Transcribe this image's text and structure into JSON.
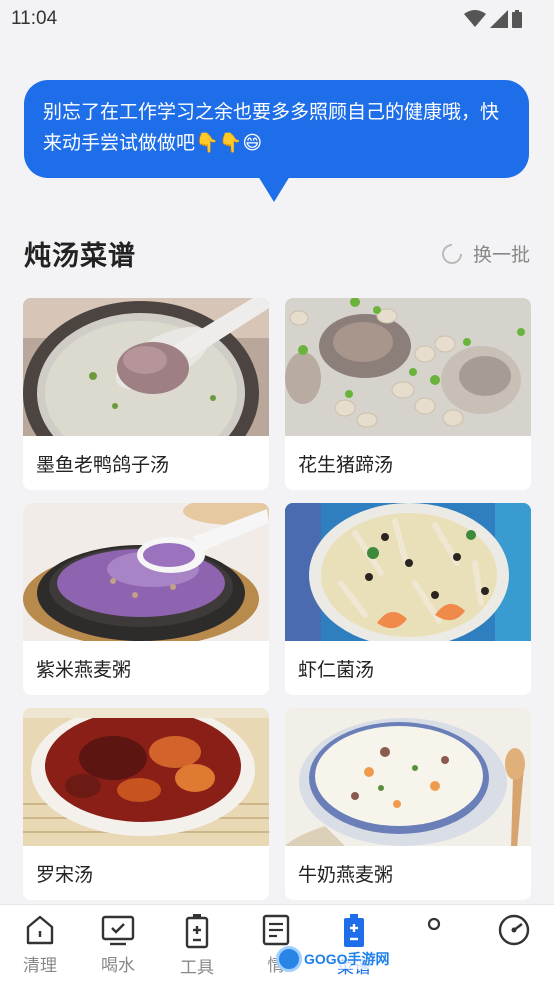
{
  "status_bar": {
    "time": "11:04"
  },
  "bubble": {
    "message": "别忘了在工作学习之余也要多多照顾自己的健康哦，快来动手尝试做做吧👇👇😄"
  },
  "section": {
    "title": "炖汤菜谱",
    "refresh_label": "换一批"
  },
  "recipes": [
    {
      "name": "墨鱼老鸭鸽子汤"
    },
    {
      "name": "花生猪蹄汤"
    },
    {
      "name": "紫米燕麦粥"
    },
    {
      "name": "虾仁菌汤"
    },
    {
      "name": "罗宋汤"
    },
    {
      "name": "牛奶燕麦粥"
    }
  ],
  "nav": {
    "items": [
      {
        "label": "清理",
        "icon": "house-icon"
      },
      {
        "label": "喝水",
        "icon": "monitor-check-icon"
      },
      {
        "label": "工具",
        "icon": "battery-plus-icon"
      },
      {
        "label": "情",
        "icon": "document-icon"
      },
      {
        "label": "菜谱",
        "icon": "battery-plus-icon"
      },
      {
        "label": "",
        "icon": "circle-icon"
      },
      {
        "label": "",
        "icon": "gauge-icon"
      }
    ],
    "active_index": 4
  },
  "watermark": {
    "text": "GOGO手游网"
  },
  "colors": {
    "accent": "#1d6ee8",
    "background": "#f3f3f5"
  }
}
